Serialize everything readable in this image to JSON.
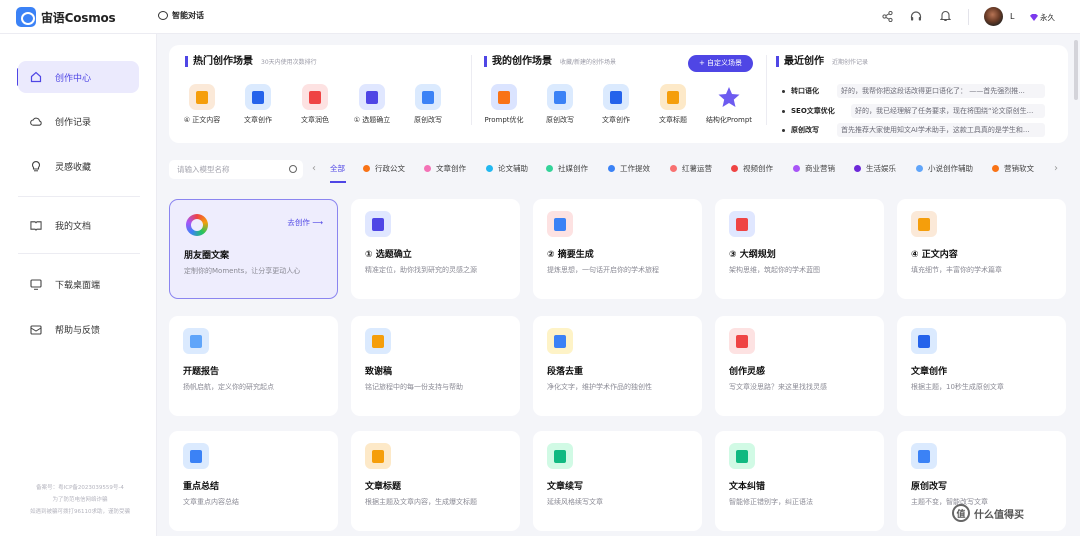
{
  "app": {
    "name": "宙语Cosmos"
  },
  "header": {
    "smart_chat": "智能对话",
    "username": "L",
    "vip_label": "永久"
  },
  "sidebar": {
    "items": [
      {
        "label": "创作中心",
        "icon": "home-icon",
        "active": true
      },
      {
        "label": "创作记录",
        "icon": "cloud-icon",
        "active": false
      },
      {
        "label": "灵感收藏",
        "icon": "lightbulb-icon",
        "active": false
      },
      {
        "label": "我的文档",
        "icon": "book-icon",
        "active": false
      },
      {
        "label": "下载桌面端",
        "icon": "monitor-icon",
        "active": false
      },
      {
        "label": "帮助与反馈",
        "icon": "mail-icon",
        "active": false
      }
    ],
    "footer": [
      "备案号：粤ICP备2023039559号-4",
      "为了防范电信网络诈骗",
      "如遇到被骗可拨打96110求助，谨防受骗"
    ]
  },
  "hot": {
    "title": "热门创作场景",
    "subtitle": "30天内使用次数排行",
    "items": [
      {
        "label": "④ 正文内容",
        "color": "#fbe9d8",
        "glyph": "#f59e0b"
      },
      {
        "label": "文章创作",
        "color": "#dbeafe",
        "glyph": "#2563eb"
      },
      {
        "label": "文章润色",
        "color": "#fde2e2",
        "glyph": "#ef4444"
      },
      {
        "label": "① 选题确立",
        "color": "#e0e7ff",
        "glyph": "#4f46e5"
      },
      {
        "label": "原创改写",
        "color": "#dbeafe",
        "glyph": "#3b82f6"
      }
    ]
  },
  "mine": {
    "title": "我的创作场景",
    "subtitle": "收藏/新建的创作场景",
    "custom_button": "+ 自定义场景",
    "items": [
      {
        "label": "Prompt优化",
        "color": "#dbe4ff",
        "glyph": "#f97316"
      },
      {
        "label": "原创改写",
        "color": "#dbeafe",
        "glyph": "#3b82f6"
      },
      {
        "label": "文章创作",
        "color": "#dbeafe",
        "glyph": "#2563eb"
      },
      {
        "label": "文章标题",
        "color": "#fde9c8",
        "glyph": "#f59e0b"
      },
      {
        "label": "结构化Prompt",
        "color": "#ffffff",
        "glyph": "#6d5bf0"
      }
    ]
  },
  "recent": {
    "title": "最近创作",
    "subtitle": "近期创作记录",
    "items": [
      {
        "name": "转口语化",
        "text": "好的，我帮你把这段话改得更口语化了： ——首先强烈推..."
      },
      {
        "name": "SEO文章优化",
        "text": "好的，我已经理解了任务要求，现在将围绕“论文原创生..."
      },
      {
        "name": "原创改写",
        "text": "首先推荐大家使用知文AI学术助手，这款工具真的是学生和..."
      }
    ]
  },
  "search": {
    "placeholder": "请输入模型名称"
  },
  "tabs": [
    {
      "label": "全部",
      "color": "",
      "active": true
    },
    {
      "label": "行政公文",
      "color": "#f97316"
    },
    {
      "label": "文章创作",
      "color": "#f472b6"
    },
    {
      "label": "论文辅助",
      "color": "#22b8f0"
    },
    {
      "label": "社媒创作",
      "color": "#34d399"
    },
    {
      "label": "工作提效",
      "color": "#3b82f6"
    },
    {
      "label": "红薯运营",
      "color": "#f87171"
    },
    {
      "label": "视频创作",
      "color": "#ef4444"
    },
    {
      "label": "商业营销",
      "color": "#a855f7"
    },
    {
      "label": "生活娱乐",
      "color": "#6d28d9"
    },
    {
      "label": "小说创作辅助",
      "color": "#60a5fa"
    },
    {
      "label": "营销软文",
      "color": "#f97316"
    }
  ],
  "cards": [
    {
      "title": "朋友圈文案",
      "desc": "定制你的Moments，让分享更动人心",
      "selected": true,
      "go": "去创作 ⟶",
      "color": "#eeedfd",
      "glyph": "ring"
    },
    {
      "title": "① 选题确立",
      "desc": "精准定位，助你找到研究的灵感之源",
      "color": "#e0e7ff",
      "glyph": "#4f46e5"
    },
    {
      "title": "② 摘要生成",
      "desc": "提炼思想，一句话开启你的学术旅程",
      "color": "#fde2e2",
      "glyph": "#3b82f6"
    },
    {
      "title": "③ 大纲规划",
      "desc": "架构思维，筑起你的学术蓝图",
      "color": "#e0e7ff",
      "glyph": "#ef4444"
    },
    {
      "title": "④ 正文内容",
      "desc": "填充细节，丰富你的学术篇章",
      "color": "#fbe9d8",
      "glyph": "#f59e0b"
    },
    {
      "title": "开题报告",
      "desc": "扬帆启航，定义你的研究起点",
      "color": "#dbeafe",
      "glyph": "#60a5fa"
    },
    {
      "title": "致谢稿",
      "desc": "铭记旅程中的每一份支持与帮助",
      "color": "#dbeafe",
      "glyph": "#f59e0b"
    },
    {
      "title": "段落去重",
      "desc": "净化文字，维护学术作品的独创性",
      "color": "#fef3c7",
      "glyph": "#3b82f6"
    },
    {
      "title": "创作灵感",
      "desc": "写文章没思路？来这里找找灵感",
      "color": "#fde2e2",
      "glyph": "#ef4444"
    },
    {
      "title": "文章创作",
      "desc": "根据主题，10秒生成原创文章",
      "color": "#dbeafe",
      "glyph": "#2563eb"
    },
    {
      "title": "重点总结",
      "desc": "文章重点内容总结",
      "color": "#dbeafe",
      "glyph": "#3b82f6"
    },
    {
      "title": "文章标题",
      "desc": "根据主题及文章内容，生成爆文标题",
      "color": "#fde9c8",
      "glyph": "#f59e0b"
    },
    {
      "title": "文章续写",
      "desc": "延续风格续写文章",
      "color": "#d1fae5",
      "glyph": "#10b981"
    },
    {
      "title": "文本纠错",
      "desc": "智能修正错别字，纠正语法",
      "color": "#d1fae5",
      "glyph": "#10b981"
    },
    {
      "title": "原创改写",
      "desc": "主题不变，智能改写文章",
      "color": "#dbeafe",
      "glyph": "#3b82f6"
    }
  ],
  "watermark": "值 什么值得买"
}
